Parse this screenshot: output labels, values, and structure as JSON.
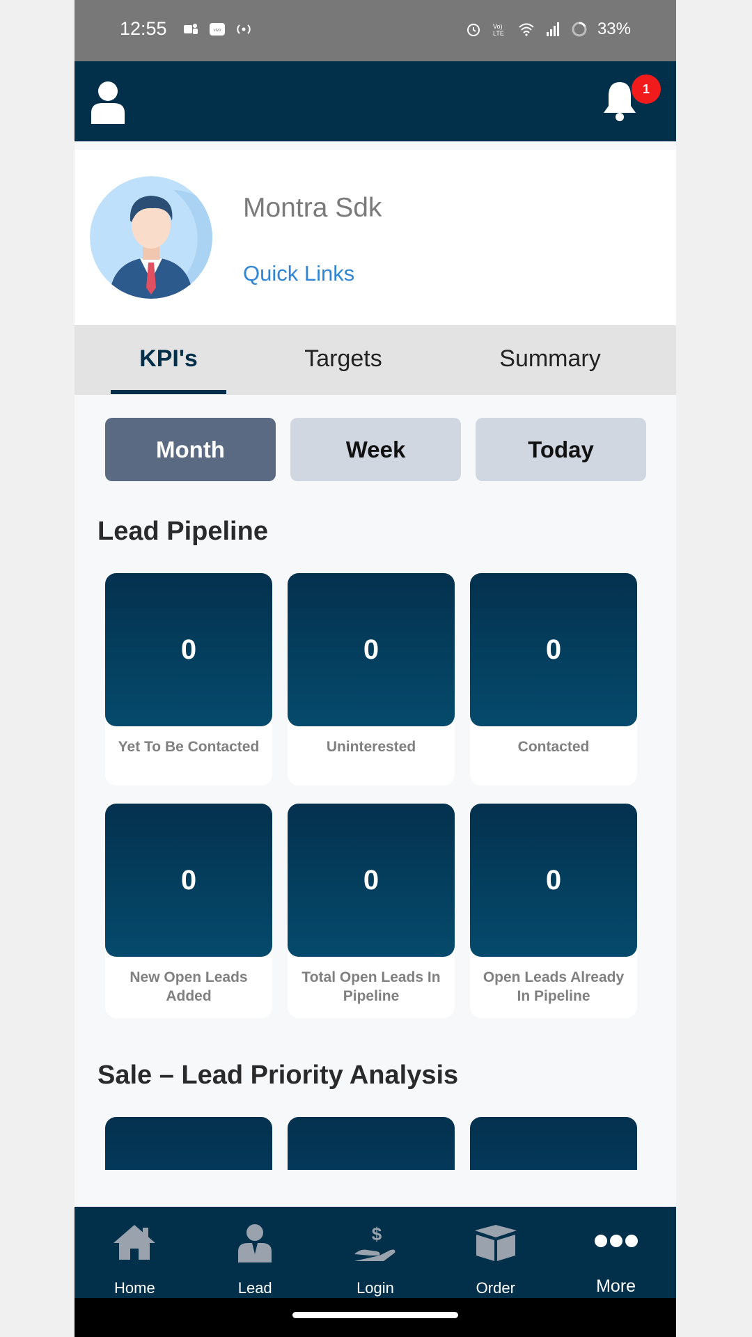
{
  "status_bar": {
    "time": "12:55",
    "battery": "33%",
    "icons": [
      "teams-icon",
      "vivo-icon",
      "hotspot-icon",
      "alarm-icon",
      "volte-icon",
      "wifi-icon",
      "signal-icon",
      "battery-ring-icon"
    ]
  },
  "header": {
    "notification_count": "1"
  },
  "profile": {
    "name": "Montra Sdk",
    "quick_links": "Quick Links"
  },
  "tabs": [
    {
      "label": "KPI's",
      "active": true
    },
    {
      "label": "Targets",
      "active": false
    },
    {
      "label": "Summary",
      "active": false
    }
  ],
  "periods": [
    {
      "label": "Month",
      "active": true
    },
    {
      "label": "Week",
      "active": false
    },
    {
      "label": "Today",
      "active": false
    }
  ],
  "lead_pipeline": {
    "title": "Lead Pipeline",
    "cards": [
      {
        "value": "0",
        "label": "Yet To Be Contacted"
      },
      {
        "value": "0",
        "label": "Uninterested"
      },
      {
        "value": "0",
        "label": "Contacted"
      },
      {
        "value": "0",
        "label": "New Open Leads Added"
      },
      {
        "value": "0",
        "label": "Total Open Leads In Pipeline"
      },
      {
        "value": "0",
        "label": "Open Leads Already In Pipeline"
      }
    ]
  },
  "priority_analysis": {
    "title": "Sale – Lead Priority Analysis"
  },
  "bottom_nav": [
    {
      "label": "Home",
      "icon": "home-icon"
    },
    {
      "label": "Lead",
      "icon": "lead-person-icon"
    },
    {
      "label": "Login",
      "icon": "money-hand-icon"
    },
    {
      "label": "Order",
      "icon": "box-icon"
    },
    {
      "label": "More",
      "icon": "more-dots-icon"
    }
  ],
  "colors": {
    "header_bg": "#02304a",
    "status_bg": "#787878",
    "accent_link": "#2f86d6",
    "badge_red": "#f21b1b",
    "period_active": "#5a6a82",
    "period_inactive": "#d0d7e1"
  }
}
